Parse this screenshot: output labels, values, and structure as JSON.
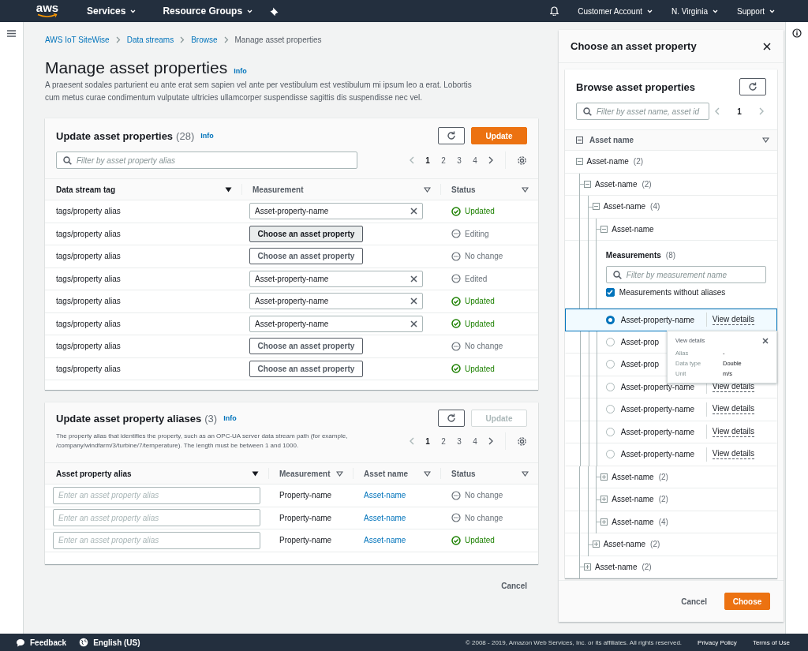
{
  "top_nav": {
    "logo": "aws",
    "menus": [
      {
        "label": "Services"
      },
      {
        "label": "Resource Groups"
      }
    ],
    "account_menus": [
      {
        "label": "Customer Account"
      },
      {
        "label": "N. Virginia"
      },
      {
        "label": "Support"
      }
    ]
  },
  "breadcrumbs": [
    {
      "label": "AWS IoT SiteWise",
      "link": true
    },
    {
      "label": "Data streams",
      "link": true
    },
    {
      "label": "Browse",
      "link": true
    },
    {
      "label": "Manage asset properties",
      "link": false
    }
  ],
  "page": {
    "title": "Manage asset properties",
    "info": "Info",
    "description": "A praesent sodales parturient eu ante erat sem sapien vel ante per vestibulum est vestibulum mi ipsum leo a erat. Lobortis cum metus curae condimentum vulputate ultricies ullamcorper suspendisse sagittis dis suspendisse nec vel."
  },
  "properties_card": {
    "title": "Update asset properties",
    "count": "(28)",
    "info": "Info",
    "update_button": {
      "label": "Update",
      "disabled": false
    },
    "filter": {
      "placeholder": "Filter by asset property alias"
    },
    "pages": [
      {
        "label": "1",
        "selected": true
      },
      {
        "label": "2",
        "selected": false
      },
      {
        "label": "3",
        "selected": false
      },
      {
        "label": "4",
        "selected": false
      }
    ],
    "columns": [
      {
        "label": "Data stream tag",
        "sorted": true
      },
      {
        "label": "Measurement",
        "sorted": false
      },
      {
        "label": "Status",
        "sorted": false
      }
    ],
    "rows": [
      {
        "tag": "tags/property alias",
        "measurement": {
          "kind": "value",
          "text": "Asset-property-name"
        },
        "status": {
          "kind": "updated",
          "text": "Updated"
        }
      },
      {
        "tag": "tags/property alias",
        "measurement": {
          "kind": "button",
          "text": "Choose an asset property",
          "active": true
        },
        "status": {
          "kind": "pending",
          "text": "Editing"
        }
      },
      {
        "tag": "tags/property alias",
        "measurement": {
          "kind": "button",
          "text": "Choose an asset property",
          "active": false
        },
        "status": {
          "kind": "pending",
          "text": "No change"
        }
      },
      {
        "tag": "tags/property alias",
        "measurement": {
          "kind": "value",
          "text": "Asset-property-name"
        },
        "status": {
          "kind": "pending",
          "text": "Edited"
        }
      },
      {
        "tag": "tags/property alias",
        "measurement": {
          "kind": "value",
          "text": "Asset-property-name"
        },
        "status": {
          "kind": "updated",
          "text": "Updated"
        }
      },
      {
        "tag": "tags/property alias",
        "measurement": {
          "kind": "value",
          "text": "Asset-property-name"
        },
        "status": {
          "kind": "updated",
          "text": "Updated"
        }
      },
      {
        "tag": "tags/property alias",
        "measurement": {
          "kind": "button",
          "text": "Choose an asset property",
          "active": false
        },
        "status": {
          "kind": "pending",
          "text": "No change"
        }
      },
      {
        "tag": "tags/property alias",
        "measurement": {
          "kind": "button",
          "text": "Choose an asset property",
          "active": false
        },
        "status": {
          "kind": "updated",
          "text": "Updated"
        }
      }
    ]
  },
  "aliases_card": {
    "title": "Update asset property aliases",
    "count": "(3)",
    "info": "Info",
    "update_button": {
      "label": "Update",
      "disabled": true
    },
    "description": "The property alias that identifies the property, such as an OPC-UA server data stream path (for example, /company/windfarm/3/turbine/7/temperature). The length must be between 1 and 1000.",
    "pages": [
      {
        "label": "1",
        "selected": true
      },
      {
        "label": "2",
        "selected": false
      },
      {
        "label": "3",
        "selected": false
      },
      {
        "label": "4",
        "selected": false
      }
    ],
    "columns": [
      {
        "label": "Asset property alias",
        "sorted": true
      },
      {
        "label": "Measurement",
        "sorted": false
      },
      {
        "label": "Asset name",
        "sorted": false
      },
      {
        "label": "Status",
        "sorted": false
      }
    ],
    "rows": [
      {
        "alias": {
          "placeholder": "Enter an asset property alias"
        },
        "measurement": "Property-name",
        "asset": "Asset-name",
        "status": {
          "kind": "pending",
          "text": "No change"
        }
      },
      {
        "alias": {
          "placeholder": "Enter an asset property alias"
        },
        "measurement": "Property-name",
        "asset": "Asset-name",
        "status": {
          "kind": "pending",
          "text": "No change"
        }
      },
      {
        "alias": {
          "placeholder": "Enter an asset property alias"
        },
        "measurement": "Property-name",
        "asset": "Asset-name",
        "status": {
          "kind": "updated",
          "text": "Updated"
        }
      }
    ]
  },
  "cancel_button": "Cancel",
  "drawer": {
    "title": "Choose an asset property",
    "browser": {
      "title": "Browse asset properties",
      "filter": {
        "placeholder": "Filter by asset name, asset id"
      },
      "page": "1",
      "column": {
        "label": "Asset name",
        "sorted": false
      },
      "tree": [
        {
          "label": "Asset-name",
          "count": "(2)",
          "expanded": true,
          "children": [
            {
              "label": "Asset-name",
              "count": "(2)",
              "expanded": true,
              "children": [
                {
                  "label": "Asset-name",
                  "count": "(4)",
                  "expanded": true,
                  "children": [
                    {
                      "label": "Asset-name",
                      "expanded": true,
                      "measurements": {
                        "title": "Measurements",
                        "count": "(8)",
                        "filter": {
                          "placeholder": "Filter by measurement name"
                        },
                        "checkbox": {
                          "label": "Measurements without aliases",
                          "checked": true
                        },
                        "items": [
                          {
                            "name": "Asset-property-name",
                            "selected": true,
                            "link": "View details",
                            "popover": {
                              "title": "View details",
                              "rows": [
                                {
                                  "label": "Alias",
                                  "value": "-"
                                },
                                {
                                  "label": "Data type",
                                  "value": "Double"
                                },
                                {
                                  "label": "Unit",
                                  "value": "m/s"
                                }
                              ]
                            }
                          },
                          {
                            "name": "Asset-prop",
                            "selected": false
                          },
                          {
                            "name": "Asset-prop",
                            "selected": false
                          },
                          {
                            "name": "Asset-property-name",
                            "selected": false,
                            "link": "View details"
                          },
                          {
                            "name": "Asset-property-name",
                            "selected": false,
                            "link": "View details"
                          },
                          {
                            "name": "Asset-property-name",
                            "selected": false,
                            "link": "View details"
                          },
                          {
                            "name": "Asset-property-name",
                            "selected": false,
                            "link": "View details"
                          }
                        ]
                      }
                    },
                    {
                      "label": "Asset-name",
                      "count": "(2)",
                      "expanded": false
                    },
                    {
                      "label": "Asset-name",
                      "count": "(2)",
                      "expanded": false
                    },
                    {
                      "label": "Asset-name",
                      "count": "(4)",
                      "expanded": false
                    }
                  ]
                },
                {
                  "label": "Asset-name",
                  "count": "(2)",
                  "expanded": false
                }
              ]
            },
            {
              "label": "Asset-name",
              "count": "(2)",
              "expanded": false
            }
          ]
        }
      ]
    },
    "cancel_button": "Cancel",
    "choose_button": "Choose"
  },
  "footer": {
    "feedback": "Feedback",
    "language": "English (US)",
    "copyright": "© 2008 - 2019, Amazon Web Services, Inc. or its affiliates. All rights reserved.",
    "links": [
      "Privacy Policy",
      "Terms of Use"
    ]
  }
}
